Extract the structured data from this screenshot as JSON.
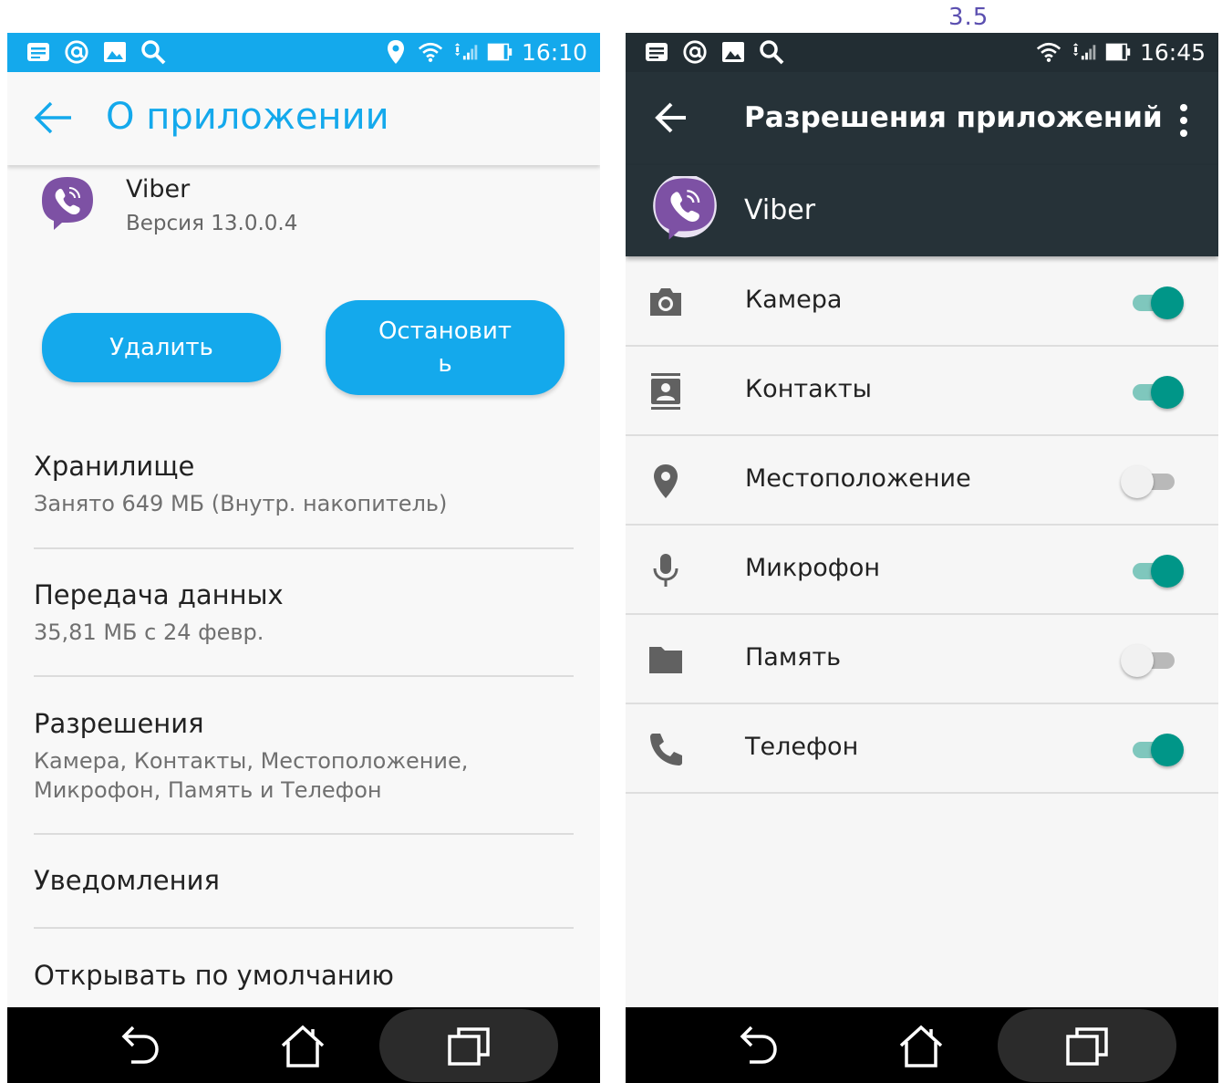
{
  "figure_label": "3.5",
  "left": {
    "status_time": "16:10",
    "title": "О приложении",
    "app_name": "Viber",
    "app_version": "Версия 13.0.0.4",
    "delete_label": "Удалить",
    "stop_label": "Остановить",
    "settings": [
      {
        "title": "Хранилище",
        "subtitle": "Занято 649 МБ (Внутр. накопитель)"
      },
      {
        "title": "Передача данных",
        "subtitle": "35,81 МБ с 24 февр."
      },
      {
        "title": "Разрешения",
        "subtitle": "Камера, Контакты, Местоположение, Микрофон, Память и Телефон"
      },
      {
        "title": "Уведомления"
      },
      {
        "title": "Открывать по умолчанию"
      }
    ],
    "colors": {
      "accent": "#14a9ec",
      "background": "#f8f8f8"
    }
  },
  "right": {
    "status_time": "16:45",
    "title": "Разрешения приложений",
    "app_name": "Viber",
    "permissions": [
      {
        "label": "Камера",
        "icon": "camera-icon",
        "enabled": true
      },
      {
        "label": "Контакты",
        "icon": "contacts-icon",
        "enabled": true
      },
      {
        "label": "Местоположение",
        "icon": "location-icon",
        "enabled": false
      },
      {
        "label": "Микрофон",
        "icon": "microphone-icon",
        "enabled": true
      },
      {
        "label": "Память",
        "icon": "folder-icon",
        "enabled": false
      },
      {
        "label": "Телефон",
        "icon": "phone-icon",
        "enabled": true
      }
    ],
    "colors": {
      "appbar": "#263238",
      "toggle_on": "#009688"
    }
  }
}
